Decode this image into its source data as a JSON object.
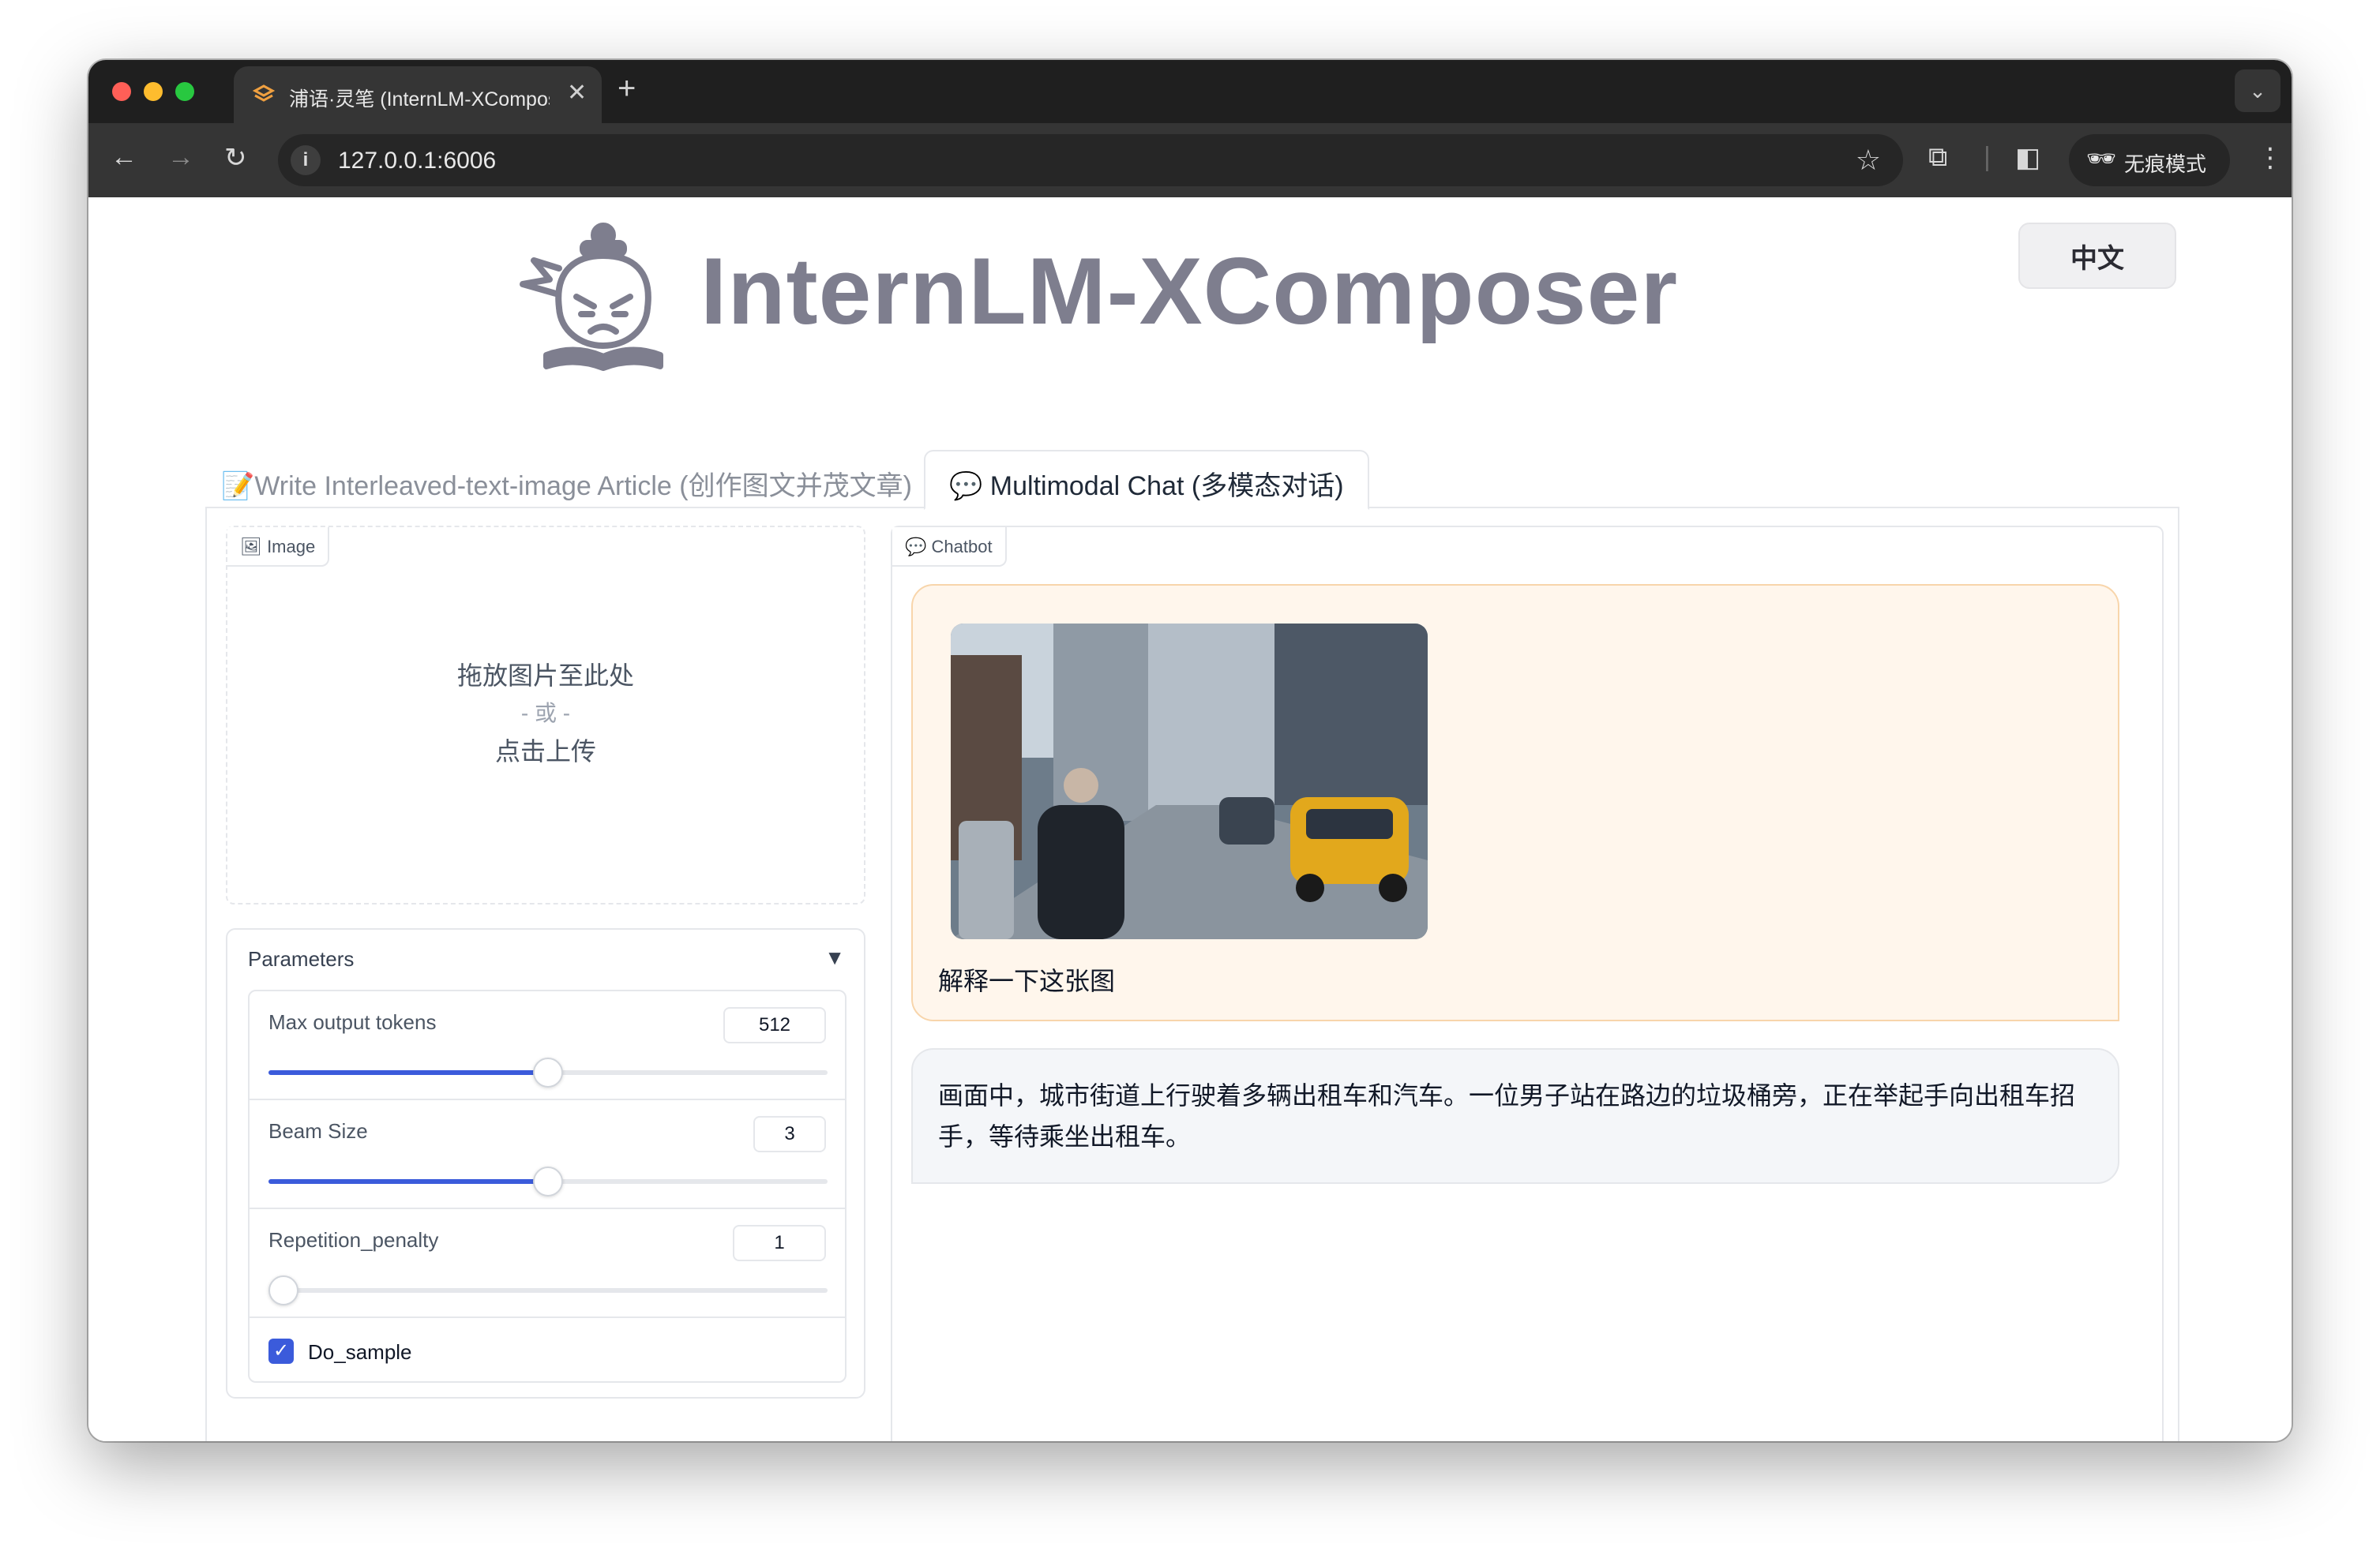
{
  "browser": {
    "tab_title": "浦语·灵笔 (InternLM-XComposer",
    "url": "127.0.0.1:6006",
    "incognito_label": "无痕模式",
    "traffic_light_colors": [
      "#ff5f57",
      "#febc2e",
      "#28c840"
    ]
  },
  "header": {
    "app_title": "InternLM-XComposer",
    "language_button": "中文"
  },
  "tabs": [
    {
      "label": "📝Write Interleaved-text-image Article (创作图文并茂文章)"
    },
    {
      "label": "💬 Multimodal Chat (多模态对话)"
    }
  ],
  "image_input": {
    "label": "Image",
    "drop_text": "拖放图片至此处",
    "or_text": "- 或 -",
    "click_text": "点击上传"
  },
  "parameters": {
    "title": "Parameters",
    "sliders": [
      {
        "label": "Max output tokens",
        "value": "512",
        "fraction": 0.5
      },
      {
        "label": "Beam Size",
        "value": "3",
        "fraction": 0.5
      },
      {
        "label": "Repetition_penalty",
        "value": "1",
        "fraction": 0.0
      }
    ],
    "do_sample": {
      "label": "Do_sample",
      "checked": true
    }
  },
  "chatbot": {
    "label": "Chatbot",
    "user_message": "解释一下这张图",
    "bot_message": "画面中，城市街道上行驶着多辆出租车和汽车。一位男子站在路边的垃圾桶旁，正在举起手向出租车招手，等待乘坐出租车。"
  },
  "colors": {
    "accent": "#3b5bdb",
    "user_bubble": "#fff6ec",
    "bot_bubble": "#f4f6f9",
    "title_gray": "#7e7e8e"
  }
}
